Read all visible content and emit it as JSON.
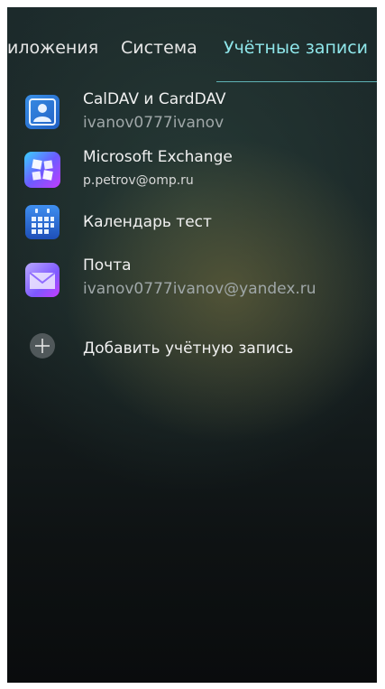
{
  "tabs": {
    "apps": "иложения",
    "system": "Система",
    "accounts": "Учётные записи"
  },
  "accounts": [
    {
      "title": "CalDAV и CardDAV",
      "subtitle": "ivanov0777ivanov",
      "icon": "contact-card-icon"
    },
    {
      "title": "Microsoft Exchange",
      "subtitle": "p.petrov@omp.ru",
      "icon": "exchange-icon"
    },
    {
      "title": "Календарь тест",
      "subtitle": "",
      "icon": "calendar-icon"
    },
    {
      "title": "Почта",
      "subtitle": "ivanov0777ivanov@yandex.ru",
      "icon": "mail-icon"
    }
  ],
  "add_account": {
    "label": "Добавить учётную запись",
    "icon": "plus-circle-icon"
  },
  "colors": {
    "accent": "#8fe6ea",
    "text_primary": "#f0f0f0",
    "text_secondary": "#9fa7a8"
  }
}
